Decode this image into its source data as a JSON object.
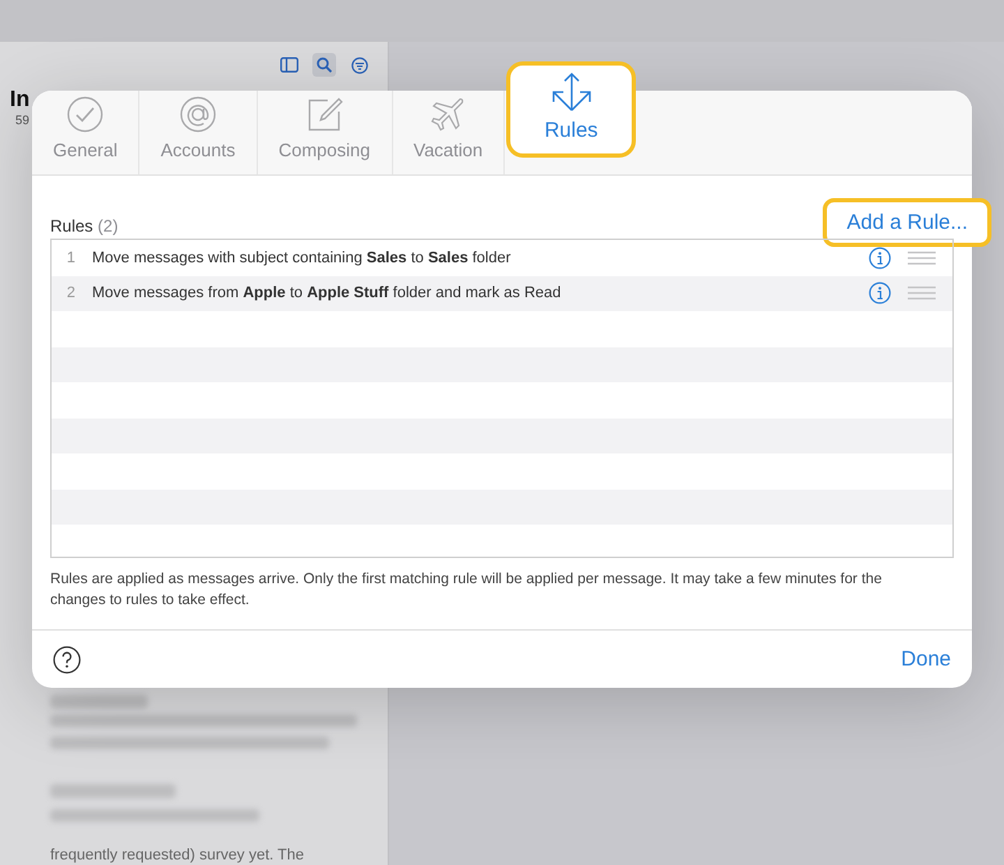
{
  "background": {
    "mailbox_title": "In",
    "mailbox_count": "59",
    "preview_text": "frequently requested) survey yet. The"
  },
  "tabs": [
    {
      "label": "General",
      "kind": "general",
      "selected": false,
      "highlighted": false
    },
    {
      "label": "Accounts",
      "kind": "accounts",
      "selected": false,
      "highlighted": false
    },
    {
      "label": "Composing",
      "kind": "composing",
      "selected": false,
      "highlighted": false
    },
    {
      "label": "Vacation",
      "kind": "vacation",
      "selected": false,
      "highlighted": false
    },
    {
      "label": "Rules",
      "kind": "rules",
      "selected": true,
      "highlighted": true
    }
  ],
  "rules_section": {
    "title": "Rules",
    "count": "(2)",
    "add_button": {
      "label": "Add a Rule...",
      "highlighted": true
    }
  },
  "rules": [
    {
      "number": "1",
      "text": "Move messages with subject containing **Sales** to **Sales** folder"
    },
    {
      "number": "2",
      "text": "Move messages from **Apple** to **Apple Stuff** folder and mark as Read"
    }
  ],
  "note": "Rules are applied as messages arrive. Only the first matching rule will be applied per message. It may take a few minutes for the changes to rules to take effect.",
  "footer": {
    "done_label": "Done"
  }
}
